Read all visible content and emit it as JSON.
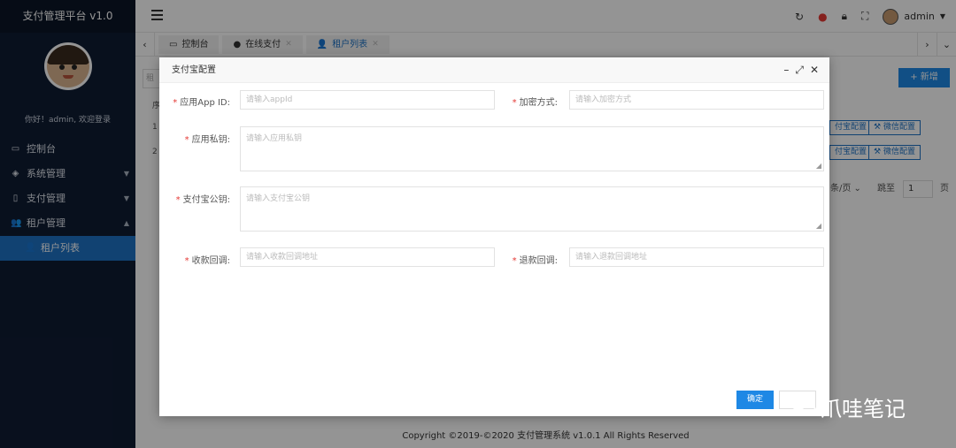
{
  "sidebar": {
    "title": "支付管理平台 v1.0",
    "welcome": "你好！admin, 欢迎登录",
    "items": [
      {
        "label": "控制台",
        "icon": "monitor-icon"
      },
      {
        "label": "系统管理",
        "icon": "layers-icon"
      },
      {
        "label": "支付管理",
        "icon": "mobile-icon"
      },
      {
        "label": "租户管理",
        "icon": "users-icon"
      },
      {
        "label": "租户列表",
        "icon": "user-icon"
      }
    ]
  },
  "topbar": {
    "user": "admin"
  },
  "tabs": [
    {
      "label": "控制台"
    },
    {
      "label": "在线支付"
    },
    {
      "label": "租户列表"
    }
  ],
  "content": {
    "add_button": "+ 新增",
    "search_placeholder": "租",
    "header_col": "序",
    "rows": [
      "1",
      "2"
    ],
    "alipay_config": "付宝配置",
    "wechat_config": "微信配置",
    "per_page": "条/页",
    "jump_label": "跳至",
    "jump_value": "1",
    "page_suffix": "页"
  },
  "modal": {
    "title": "支付宝配置",
    "fields": {
      "appid_label": "应用App ID:",
      "appid_placeholder": "请输入appId",
      "encrypt_label": "加密方式:",
      "encrypt_placeholder": "请输入加密方式",
      "private_key_label": "应用私钥:",
      "private_key_placeholder": "请输入应用私钥",
      "public_key_label": "支付宝公钥:",
      "public_key_placeholder": "请输入支付宝公钥",
      "notify_label": "收款回调:",
      "notify_placeholder": "请输入收款回调地址",
      "refund_label": "退款回调:",
      "refund_placeholder": "请输入退款回调地址"
    },
    "confirm": "确定"
  },
  "footer": {
    "copyright": "Copyright ©2019-©2020 支付管理系统 v1.0.1 All Rights Reserved"
  },
  "watermark": {
    "text": "爪哇笔记"
  }
}
